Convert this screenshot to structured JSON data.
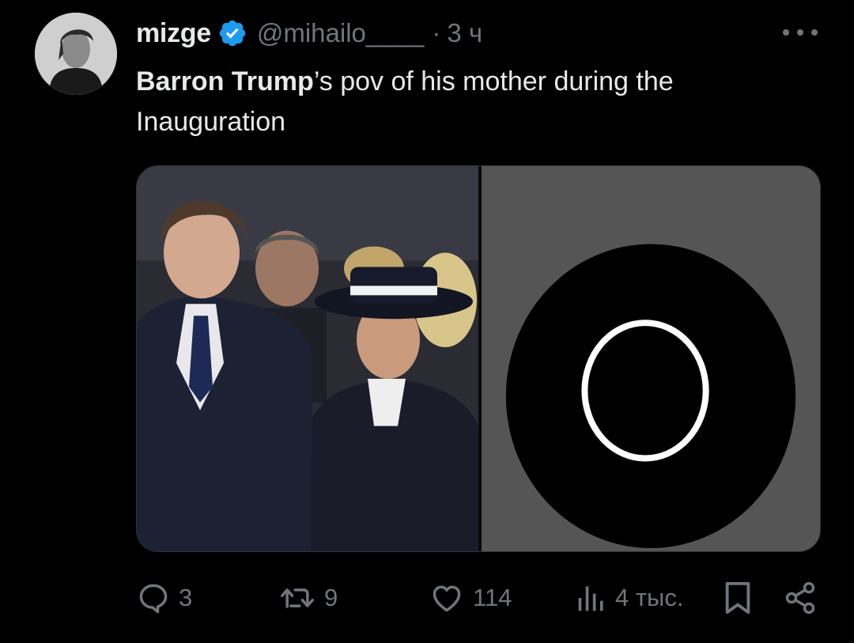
{
  "author": {
    "display_name": "mizge",
    "handle": "@mihailo____",
    "separator": "·",
    "time": "3 ч",
    "verified_color": "#1d9bf0"
  },
  "tweet": {
    "text_bold": "Barron Trump",
    "text_rest": "’s pov of his mother during the Inauguration"
  },
  "media": {
    "count": 2,
    "right_background": "#555555"
  },
  "actions": {
    "replies": "3",
    "retweets": "9",
    "likes": "114",
    "views": "4 тыс."
  },
  "colors": {
    "background": "#000000",
    "text": "#e7e9ea",
    "muted": "#71767b"
  }
}
